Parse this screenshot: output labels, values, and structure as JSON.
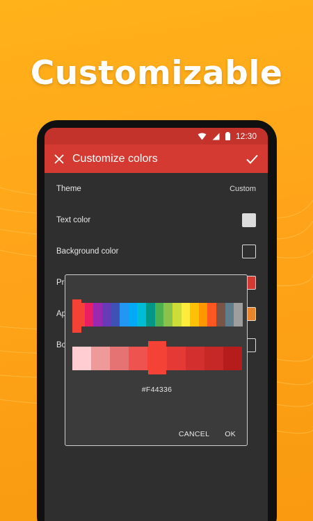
{
  "headline": "Customizable",
  "status_bar": {
    "time": "12:30"
  },
  "app_bar": {
    "title": "Customize colors"
  },
  "settings": [
    {
      "label": "Theme",
      "value": "Custom"
    },
    {
      "label": "Text color",
      "swatch": "#dcdcdc"
    },
    {
      "label": "Background color",
      "swatch": "#2f2f2f"
    },
    {
      "label": "Pr",
      "swatch": "#d43a31"
    },
    {
      "label": "Ap",
      "swatch": "#e8842a"
    },
    {
      "label": "Bo",
      "swatch": "#2f2f2f"
    }
  ],
  "color_picker": {
    "hue_colors": [
      "#f44336",
      "#e91e63",
      "#9c27b0",
      "#673ab7",
      "#3f51b5",
      "#2196f3",
      "#03a9f4",
      "#00bcd4",
      "#009688",
      "#4caf50",
      "#8bc34a",
      "#cddc39",
      "#ffeb3b",
      "#ffc107",
      "#ff9800",
      "#ff5722",
      "#795548",
      "#607d8b",
      "#9e9e9e"
    ],
    "shade_colors": [
      "#ffcdd2",
      "#ef9a9a",
      "#e57373",
      "#ef5350",
      "#f44336",
      "#e53935",
      "#d32f2f",
      "#c62828",
      "#b71c1c"
    ],
    "selected_hex": "#F44336",
    "cancel_label": "CANCEL",
    "ok_label": "OK"
  }
}
